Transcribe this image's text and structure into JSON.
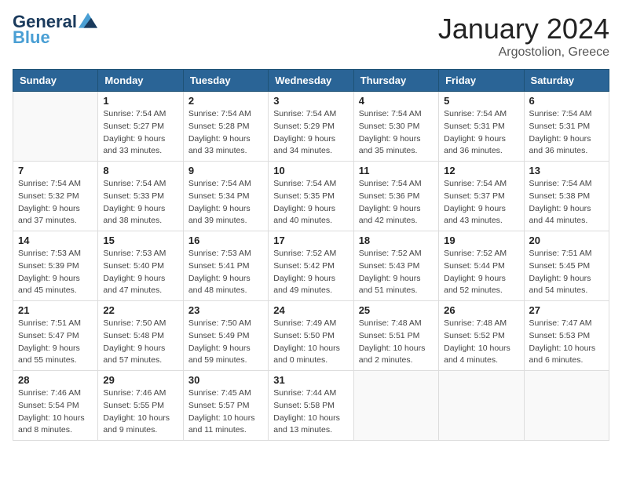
{
  "header": {
    "logo_line1": "General",
    "logo_line2": "Blue",
    "month": "January 2024",
    "location": "Argostolion, Greece"
  },
  "weekdays": [
    "Sunday",
    "Monday",
    "Tuesday",
    "Wednesday",
    "Thursday",
    "Friday",
    "Saturday"
  ],
  "weeks": [
    [
      {
        "day": "",
        "sunrise": "",
        "sunset": "",
        "daylight": ""
      },
      {
        "day": "1",
        "sunrise": "Sunrise: 7:54 AM",
        "sunset": "Sunset: 5:27 PM",
        "daylight": "Daylight: 9 hours and 33 minutes."
      },
      {
        "day": "2",
        "sunrise": "Sunrise: 7:54 AM",
        "sunset": "Sunset: 5:28 PM",
        "daylight": "Daylight: 9 hours and 33 minutes."
      },
      {
        "day": "3",
        "sunrise": "Sunrise: 7:54 AM",
        "sunset": "Sunset: 5:29 PM",
        "daylight": "Daylight: 9 hours and 34 minutes."
      },
      {
        "day": "4",
        "sunrise": "Sunrise: 7:54 AM",
        "sunset": "Sunset: 5:30 PM",
        "daylight": "Daylight: 9 hours and 35 minutes."
      },
      {
        "day": "5",
        "sunrise": "Sunrise: 7:54 AM",
        "sunset": "Sunset: 5:31 PM",
        "daylight": "Daylight: 9 hours and 36 minutes."
      },
      {
        "day": "6",
        "sunrise": "Sunrise: 7:54 AM",
        "sunset": "Sunset: 5:31 PM",
        "daylight": "Daylight: 9 hours and 36 minutes."
      }
    ],
    [
      {
        "day": "7",
        "sunrise": "Sunrise: 7:54 AM",
        "sunset": "Sunset: 5:32 PM",
        "daylight": "Daylight: 9 hours and 37 minutes."
      },
      {
        "day": "8",
        "sunrise": "Sunrise: 7:54 AM",
        "sunset": "Sunset: 5:33 PM",
        "daylight": "Daylight: 9 hours and 38 minutes."
      },
      {
        "day": "9",
        "sunrise": "Sunrise: 7:54 AM",
        "sunset": "Sunset: 5:34 PM",
        "daylight": "Daylight: 9 hours and 39 minutes."
      },
      {
        "day": "10",
        "sunrise": "Sunrise: 7:54 AM",
        "sunset": "Sunset: 5:35 PM",
        "daylight": "Daylight: 9 hours and 40 minutes."
      },
      {
        "day": "11",
        "sunrise": "Sunrise: 7:54 AM",
        "sunset": "Sunset: 5:36 PM",
        "daylight": "Daylight: 9 hours and 42 minutes."
      },
      {
        "day": "12",
        "sunrise": "Sunrise: 7:54 AM",
        "sunset": "Sunset: 5:37 PM",
        "daylight": "Daylight: 9 hours and 43 minutes."
      },
      {
        "day": "13",
        "sunrise": "Sunrise: 7:54 AM",
        "sunset": "Sunset: 5:38 PM",
        "daylight": "Daylight: 9 hours and 44 minutes."
      }
    ],
    [
      {
        "day": "14",
        "sunrise": "Sunrise: 7:53 AM",
        "sunset": "Sunset: 5:39 PM",
        "daylight": "Daylight: 9 hours and 45 minutes."
      },
      {
        "day": "15",
        "sunrise": "Sunrise: 7:53 AM",
        "sunset": "Sunset: 5:40 PM",
        "daylight": "Daylight: 9 hours and 47 minutes."
      },
      {
        "day": "16",
        "sunrise": "Sunrise: 7:53 AM",
        "sunset": "Sunset: 5:41 PM",
        "daylight": "Daylight: 9 hours and 48 minutes."
      },
      {
        "day": "17",
        "sunrise": "Sunrise: 7:52 AM",
        "sunset": "Sunset: 5:42 PM",
        "daylight": "Daylight: 9 hours and 49 minutes."
      },
      {
        "day": "18",
        "sunrise": "Sunrise: 7:52 AM",
        "sunset": "Sunset: 5:43 PM",
        "daylight": "Daylight: 9 hours and 51 minutes."
      },
      {
        "day": "19",
        "sunrise": "Sunrise: 7:52 AM",
        "sunset": "Sunset: 5:44 PM",
        "daylight": "Daylight: 9 hours and 52 minutes."
      },
      {
        "day": "20",
        "sunrise": "Sunrise: 7:51 AM",
        "sunset": "Sunset: 5:45 PM",
        "daylight": "Daylight: 9 hours and 54 minutes."
      }
    ],
    [
      {
        "day": "21",
        "sunrise": "Sunrise: 7:51 AM",
        "sunset": "Sunset: 5:47 PM",
        "daylight": "Daylight: 9 hours and 55 minutes."
      },
      {
        "day": "22",
        "sunrise": "Sunrise: 7:50 AM",
        "sunset": "Sunset: 5:48 PM",
        "daylight": "Daylight: 9 hours and 57 minutes."
      },
      {
        "day": "23",
        "sunrise": "Sunrise: 7:50 AM",
        "sunset": "Sunset: 5:49 PM",
        "daylight": "Daylight: 9 hours and 59 minutes."
      },
      {
        "day": "24",
        "sunrise": "Sunrise: 7:49 AM",
        "sunset": "Sunset: 5:50 PM",
        "daylight": "Daylight: 10 hours and 0 minutes."
      },
      {
        "day": "25",
        "sunrise": "Sunrise: 7:48 AM",
        "sunset": "Sunset: 5:51 PM",
        "daylight": "Daylight: 10 hours and 2 minutes."
      },
      {
        "day": "26",
        "sunrise": "Sunrise: 7:48 AM",
        "sunset": "Sunset: 5:52 PM",
        "daylight": "Daylight: 10 hours and 4 minutes."
      },
      {
        "day": "27",
        "sunrise": "Sunrise: 7:47 AM",
        "sunset": "Sunset: 5:53 PM",
        "daylight": "Daylight: 10 hours and 6 minutes."
      }
    ],
    [
      {
        "day": "28",
        "sunrise": "Sunrise: 7:46 AM",
        "sunset": "Sunset: 5:54 PM",
        "daylight": "Daylight: 10 hours and 8 minutes."
      },
      {
        "day": "29",
        "sunrise": "Sunrise: 7:46 AM",
        "sunset": "Sunset: 5:55 PM",
        "daylight": "Daylight: 10 hours and 9 minutes."
      },
      {
        "day": "30",
        "sunrise": "Sunrise: 7:45 AM",
        "sunset": "Sunset: 5:57 PM",
        "daylight": "Daylight: 10 hours and 11 minutes."
      },
      {
        "day": "31",
        "sunrise": "Sunrise: 7:44 AM",
        "sunset": "Sunset: 5:58 PM",
        "daylight": "Daylight: 10 hours and 13 minutes."
      },
      {
        "day": "",
        "sunrise": "",
        "sunset": "",
        "daylight": ""
      },
      {
        "day": "",
        "sunrise": "",
        "sunset": "",
        "daylight": ""
      },
      {
        "day": "",
        "sunrise": "",
        "sunset": "",
        "daylight": ""
      }
    ]
  ]
}
